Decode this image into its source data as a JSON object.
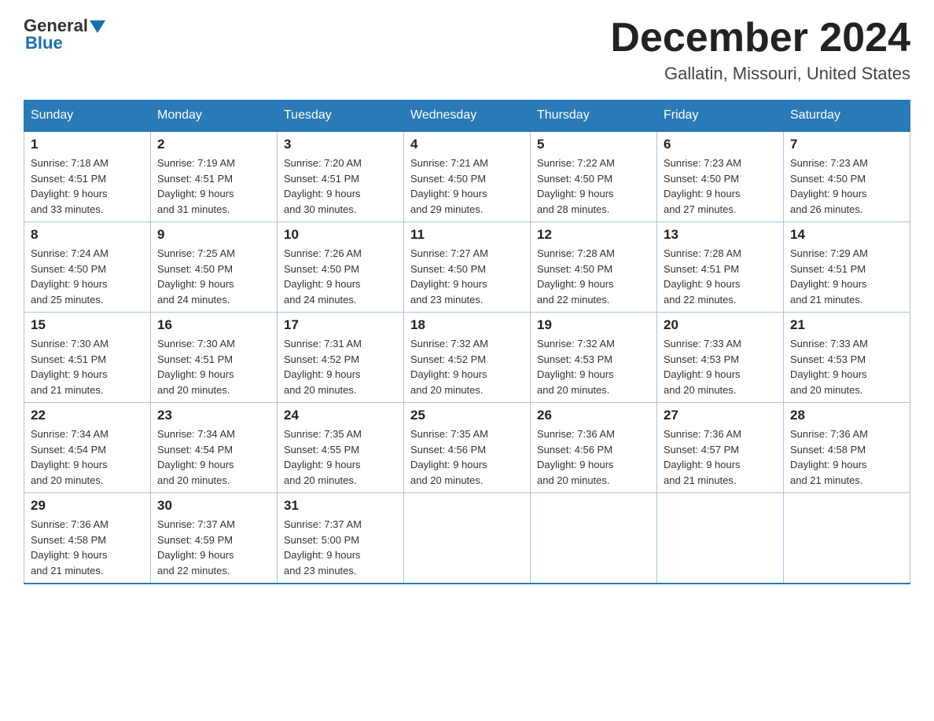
{
  "header": {
    "logo": {
      "general": "General",
      "blue": "Blue"
    },
    "title": "December 2024",
    "location": "Gallatin, Missouri, United States"
  },
  "weekdays": [
    "Sunday",
    "Monday",
    "Tuesday",
    "Wednesday",
    "Thursday",
    "Friday",
    "Saturday"
  ],
  "weeks": [
    [
      {
        "day": "1",
        "sunrise": "7:18 AM",
        "sunset": "4:51 PM",
        "daylight": "9 hours and 33 minutes."
      },
      {
        "day": "2",
        "sunrise": "7:19 AM",
        "sunset": "4:51 PM",
        "daylight": "9 hours and 31 minutes."
      },
      {
        "day": "3",
        "sunrise": "7:20 AM",
        "sunset": "4:51 PM",
        "daylight": "9 hours and 30 minutes."
      },
      {
        "day": "4",
        "sunrise": "7:21 AM",
        "sunset": "4:50 PM",
        "daylight": "9 hours and 29 minutes."
      },
      {
        "day": "5",
        "sunrise": "7:22 AM",
        "sunset": "4:50 PM",
        "daylight": "9 hours and 28 minutes."
      },
      {
        "day": "6",
        "sunrise": "7:23 AM",
        "sunset": "4:50 PM",
        "daylight": "9 hours and 27 minutes."
      },
      {
        "day": "7",
        "sunrise": "7:23 AM",
        "sunset": "4:50 PM",
        "daylight": "9 hours and 26 minutes."
      }
    ],
    [
      {
        "day": "8",
        "sunrise": "7:24 AM",
        "sunset": "4:50 PM",
        "daylight": "9 hours and 25 minutes."
      },
      {
        "day": "9",
        "sunrise": "7:25 AM",
        "sunset": "4:50 PM",
        "daylight": "9 hours and 24 minutes."
      },
      {
        "day": "10",
        "sunrise": "7:26 AM",
        "sunset": "4:50 PM",
        "daylight": "9 hours and 24 minutes."
      },
      {
        "day": "11",
        "sunrise": "7:27 AM",
        "sunset": "4:50 PM",
        "daylight": "9 hours and 23 minutes."
      },
      {
        "day": "12",
        "sunrise": "7:28 AM",
        "sunset": "4:50 PM",
        "daylight": "9 hours and 22 minutes."
      },
      {
        "day": "13",
        "sunrise": "7:28 AM",
        "sunset": "4:51 PM",
        "daylight": "9 hours and 22 minutes."
      },
      {
        "day": "14",
        "sunrise": "7:29 AM",
        "sunset": "4:51 PM",
        "daylight": "9 hours and 21 minutes."
      }
    ],
    [
      {
        "day": "15",
        "sunrise": "7:30 AM",
        "sunset": "4:51 PM",
        "daylight": "9 hours and 21 minutes."
      },
      {
        "day": "16",
        "sunrise": "7:30 AM",
        "sunset": "4:51 PM",
        "daylight": "9 hours and 20 minutes."
      },
      {
        "day": "17",
        "sunrise": "7:31 AM",
        "sunset": "4:52 PM",
        "daylight": "9 hours and 20 minutes."
      },
      {
        "day": "18",
        "sunrise": "7:32 AM",
        "sunset": "4:52 PM",
        "daylight": "9 hours and 20 minutes."
      },
      {
        "day": "19",
        "sunrise": "7:32 AM",
        "sunset": "4:53 PM",
        "daylight": "9 hours and 20 minutes."
      },
      {
        "day": "20",
        "sunrise": "7:33 AM",
        "sunset": "4:53 PM",
        "daylight": "9 hours and 20 minutes."
      },
      {
        "day": "21",
        "sunrise": "7:33 AM",
        "sunset": "4:53 PM",
        "daylight": "9 hours and 20 minutes."
      }
    ],
    [
      {
        "day": "22",
        "sunrise": "7:34 AM",
        "sunset": "4:54 PM",
        "daylight": "9 hours and 20 minutes."
      },
      {
        "day": "23",
        "sunrise": "7:34 AM",
        "sunset": "4:54 PM",
        "daylight": "9 hours and 20 minutes."
      },
      {
        "day": "24",
        "sunrise": "7:35 AM",
        "sunset": "4:55 PM",
        "daylight": "9 hours and 20 minutes."
      },
      {
        "day": "25",
        "sunrise": "7:35 AM",
        "sunset": "4:56 PM",
        "daylight": "9 hours and 20 minutes."
      },
      {
        "day": "26",
        "sunrise": "7:36 AM",
        "sunset": "4:56 PM",
        "daylight": "9 hours and 20 minutes."
      },
      {
        "day": "27",
        "sunrise": "7:36 AM",
        "sunset": "4:57 PM",
        "daylight": "9 hours and 21 minutes."
      },
      {
        "day": "28",
        "sunrise": "7:36 AM",
        "sunset": "4:58 PM",
        "daylight": "9 hours and 21 minutes."
      }
    ],
    [
      {
        "day": "29",
        "sunrise": "7:36 AM",
        "sunset": "4:58 PM",
        "daylight": "9 hours and 21 minutes."
      },
      {
        "day": "30",
        "sunrise": "7:37 AM",
        "sunset": "4:59 PM",
        "daylight": "9 hours and 22 minutes."
      },
      {
        "day": "31",
        "sunrise": "7:37 AM",
        "sunset": "5:00 PM",
        "daylight": "9 hours and 23 minutes."
      },
      null,
      null,
      null,
      null
    ]
  ]
}
